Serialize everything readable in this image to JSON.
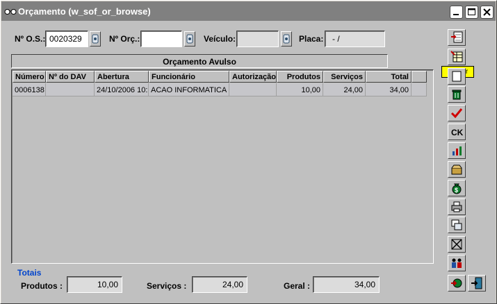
{
  "window": {
    "title": "Orçamento (w_sof_or_browse)",
    "icon": "eyeglasses-icon"
  },
  "search": {
    "os_label": "Nº O.S.:",
    "os_value": "0020329",
    "orc_label": "Nº Orç.:",
    "orc_value": "",
    "veiculo_label": "Veículo:",
    "veiculo_value": "",
    "placa_label": "Placa:",
    "placa_value": "-   /"
  },
  "section": {
    "title": "Orçamento Avulso"
  },
  "grid": {
    "columns": [
      "Número",
      "Nº do DAV",
      "Abertura",
      "Funcionário",
      "Autorização",
      "Produtos",
      "Serviços",
      "Total"
    ],
    "rows": [
      [
        "0006138",
        "",
        "24/10/2006  10:",
        "ACAO INFORMATICA",
        "",
        "10,00",
        "24,00",
        "34,00"
      ]
    ]
  },
  "totals": {
    "title": "Totais",
    "produtos_label": "Produtos :",
    "produtos_value": "10,00",
    "servicos_label": "Serviços :",
    "servicos_value": "24,00",
    "geral_label": "Geral :",
    "geral_value": "34,00"
  },
  "toolbar": {
    "tooltip": "Alterar",
    "ck_label": "CK",
    "buttons": [
      "include-icon",
      "edit-icon",
      "view-icon",
      "trash-icon",
      "check-icon",
      "ck-icon",
      "chart-icon",
      "box-icon",
      "money-bag-icon",
      "printer-icon",
      "copy-icon",
      "cancel-icon",
      "transfer-icon",
      "enter-icon",
      "exit-door-icon"
    ]
  },
  "colors": {
    "titlebar": "#808080",
    "window_bg": "#c0c0c0",
    "totals_title": "#0044cc",
    "tooltip_bg": "#ffff00"
  }
}
